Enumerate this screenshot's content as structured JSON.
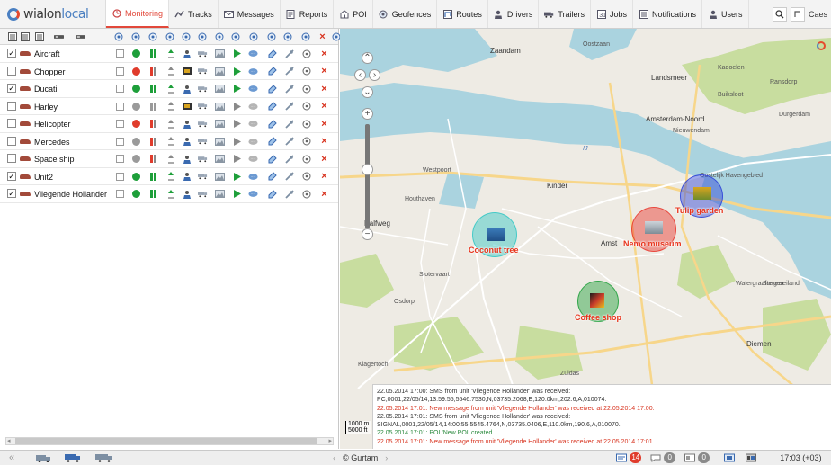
{
  "app": {
    "logo_prefix": "wialon",
    "logo_suffix": "local"
  },
  "nav": {
    "tabs": [
      {
        "label": "Monitoring",
        "icon": "monitoring-icon",
        "active": true
      },
      {
        "label": "Tracks",
        "icon": "tracks-icon"
      },
      {
        "label": "Messages",
        "icon": "messages-icon"
      },
      {
        "label": "Reports",
        "icon": "reports-icon"
      },
      {
        "label": "POI",
        "icon": "poi-icon"
      },
      {
        "label": "Geofences",
        "icon": "geofences-icon"
      },
      {
        "label": "Routes",
        "icon": "routes-icon"
      },
      {
        "label": "Drivers",
        "icon": "drivers-icon"
      },
      {
        "label": "Trailers",
        "icon": "trailers-icon"
      },
      {
        "label": "Jobs",
        "icon": "jobs-icon"
      },
      {
        "label": "Notifications",
        "icon": "notifications-icon"
      },
      {
        "label": "Users",
        "icon": "users-icon"
      }
    ],
    "user_label": "Caes"
  },
  "units": [
    {
      "name": "Aircraft",
      "checked": true,
      "status": "green",
      "sensor": "green",
      "video": false,
      "play": true
    },
    {
      "name": "Chopper",
      "checked": false,
      "status": "red",
      "sensor": "red",
      "video": true,
      "play": true
    },
    {
      "name": "Ducati",
      "checked": true,
      "status": "green",
      "sensor": "green",
      "video": false,
      "play": true
    },
    {
      "name": "Harley",
      "checked": false,
      "status": "gray",
      "sensor": "gray",
      "video": true,
      "play": false
    },
    {
      "name": "Helicopter",
      "checked": false,
      "status": "red",
      "sensor": "red",
      "video": false,
      "play": false
    },
    {
      "name": "Mercedes",
      "checked": false,
      "status": "gray",
      "sensor": "red",
      "video": false,
      "play": false
    },
    {
      "name": "Space ship",
      "checked": false,
      "status": "gray",
      "sensor": "red",
      "video": false,
      "play": false
    },
    {
      "name": "Unit2",
      "checked": true,
      "status": "green",
      "sensor": "green",
      "video": false,
      "play": true
    },
    {
      "name": "Vliegende Hollander",
      "checked": true,
      "status": "green",
      "sensor": "green",
      "video": false,
      "play": true
    }
  ],
  "map": {
    "labels": [
      {
        "text": "Zaandam",
        "cls": "big"
      },
      {
        "text": "Oostzaan"
      },
      {
        "text": "Landsmeer",
        "cls": "big"
      },
      {
        "text": "Amsterdam-Noord",
        "cls": "big"
      },
      {
        "text": "Ransdorp"
      },
      {
        "text": "Diemen",
        "cls": "big"
      },
      {
        "text": "Amst",
        "cls": "big"
      },
      {
        "text": "Halfweg",
        "cls": "big"
      },
      {
        "text": "Kinder",
        "cls": "big"
      },
      {
        "text": "IJ",
        "cls": "water"
      },
      {
        "text": "Durgerdam"
      },
      {
        "text": "Buiksloot"
      },
      {
        "text": "Westpoort"
      },
      {
        "text": "Houthaven"
      },
      {
        "text": "Kadoelen"
      },
      {
        "text": "Nieuwendam"
      },
      {
        "text": "Watergraafsmeer"
      },
      {
        "text": "Slotervaart"
      },
      {
        "text": "Osdorp"
      },
      {
        "text": "Klagertoch"
      },
      {
        "text": "Zuidas"
      },
      {
        "text": "Steigereiland"
      },
      {
        "text": "Oostelijk Havengebied"
      }
    ],
    "geofences": [
      {
        "name": "Coconut tree",
        "color": "#2fc6c4"
      },
      {
        "name": "Nemo museum",
        "color": "#e8342a"
      },
      {
        "name": "Tulip garden",
        "color": "#2b40d8"
      },
      {
        "name": "Coffee shop",
        "color": "#1e9f3a"
      }
    ],
    "scale": [
      "1000 m",
      "5000 ft"
    ],
    "messages": [
      {
        "text": "22.05.2014 17:00: SMS from unit 'Vliegende Hollander' was received:",
        "cls": "m-time"
      },
      {
        "text": "PC,0001,22/05/14,13:59:55,5546.7530,N,03735.2068,E,120.0km,202.6,A,010074.",
        "cls": "m-time"
      },
      {
        "text": "22.05.2014 17:01: New message from unit 'Vliegende Hollander' was received at 22.05.2014 17:00.",
        "cls": "m-red"
      },
      {
        "text": "22.05.2014 17:01: SMS from unit 'Vliegende Hollander' was received:",
        "cls": "m-time"
      },
      {
        "text": "SIGNAL,0001,22/05/14,14:00:55,5545.4764,N,03735.0406,E,110.0km,190.6,A,010070.",
        "cls": "m-time"
      },
      {
        "text": "22.05.2014 17:01: POI 'New POI' created.",
        "cls": "m-green"
      },
      {
        "text": "22.05.2014 17:01: New message from unit 'Vliegende Hollander' was received at 22.05.2014 17:01.",
        "cls": "m-red"
      }
    ]
  },
  "bottom": {
    "copyright": "© Gurtam",
    "notifications_count": "14",
    "messages_count": "0",
    "events_count": "0",
    "time": "17:03 (+03)"
  }
}
